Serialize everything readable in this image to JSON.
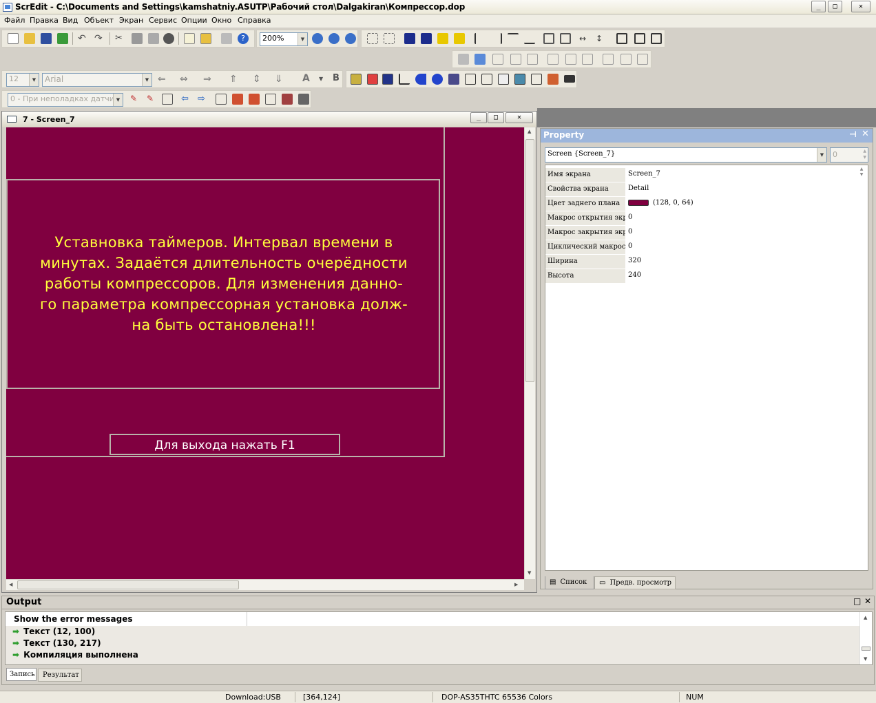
{
  "app": {
    "title": "ScrEdit - C:\\Documents and Settings\\kamshatniy.ASUTP\\Рабочий стол\\Dalgakiran\\Компрессор.dop"
  },
  "window_controls": {
    "minimize": "_",
    "maximize": "□",
    "close": "✕"
  },
  "menu": [
    "Файл",
    "Правка",
    "Вид",
    "Объект",
    "Экран",
    "Сервис",
    "Опции",
    "Окно",
    "Справка"
  ],
  "toolbar": {
    "zoom": "200%",
    "font_size": "12",
    "font_name": "Arial",
    "state": "0 - При неполадках датчи"
  },
  "child_window": {
    "title": "7 - Screen_7"
  },
  "screen": {
    "message_lines": [
      "Уставновка таймеров. Интервал времени в",
      "минутах. Задаётся длительность очерёдности",
      "работы компрессоров. Для изменения  данно-",
      "го параметра компрессорная установка долж-",
      "на быть остановлена!!!"
    ],
    "exit_hint": "Для выхода нажать F1",
    "background_color": "#800040",
    "text_color": "#ffff3c"
  },
  "property": {
    "title": "Property",
    "object_selector": "Screen {Screen_7}",
    "index_value": "0",
    "rows": [
      {
        "key": "Имя экрана",
        "value": "Screen_7"
      },
      {
        "key": "Свойства экрана",
        "value": "Detail"
      },
      {
        "key": "Цвет заднего плана",
        "value": "(128, 0, 64)",
        "swatch": "#800040"
      },
      {
        "key": "Макрос открытия экр",
        "value": "0"
      },
      {
        "key": "Макрос закрытия экр",
        "value": "0"
      },
      {
        "key": "Циклический макрос :",
        "value": "0"
      },
      {
        "key": "Ширина",
        "value": "320"
      },
      {
        "key": "Высота",
        "value": "240"
      }
    ],
    "tabs": [
      "Список",
      "Предв. просмотр"
    ]
  },
  "output": {
    "title": "Output",
    "header": "Show the error messages",
    "lines": [
      "Текст (12, 100)",
      "Текст (130, 217)",
      "Компиляция выполнена"
    ],
    "tabs": [
      "Запись",
      "Результат"
    ]
  },
  "status": {
    "download": "Download:USB",
    "coords": "[364,124]",
    "device": "DOP-AS35THTC 65536 Colors",
    "num": "NUM"
  },
  "icons": [
    "new-file-icon",
    "open-folder-icon",
    "save-icon",
    "export-icon",
    "undo-icon",
    "redo-icon",
    "cut-icon",
    "copy-icon",
    "paste-icon",
    "find-icon",
    "new-screen-icon",
    "open-screen-icon",
    "print-icon",
    "help-icon",
    "zoom-in-icon",
    "zoom-out-icon",
    "zoom-fit-icon"
  ]
}
